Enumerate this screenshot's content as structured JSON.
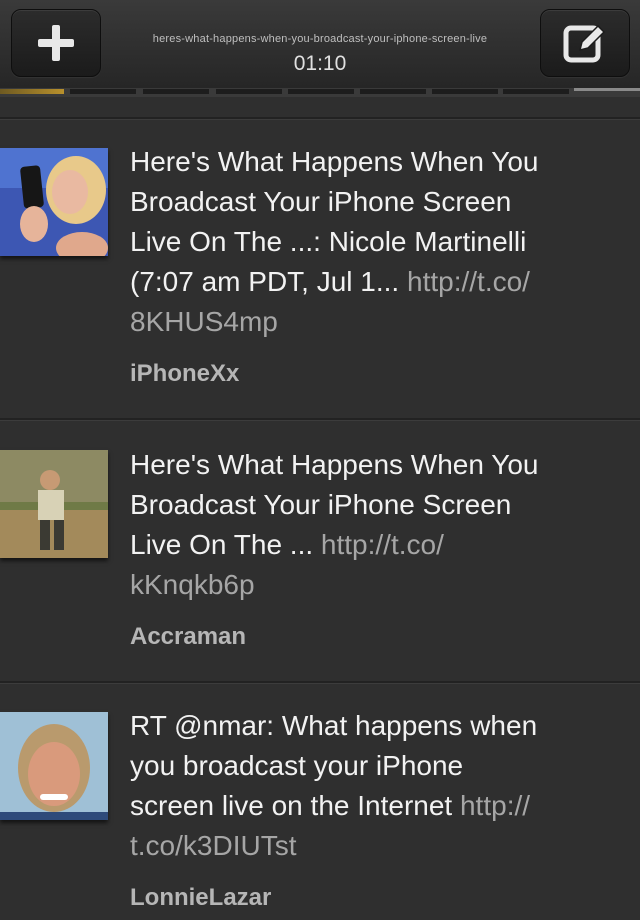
{
  "header": {
    "add_icon": "plus-icon",
    "compose_icon": "compose-icon",
    "title_slug": "heres-what-happens-when-you-broadcast-your-iphone-screen-live",
    "time": "01:10"
  },
  "playback": {
    "progress": 0.1
  },
  "tweets": [
    {
      "text_line1": "Here's What Happens When You",
      "text_line2": "Broadcast Your iPhone Screen",
      "text_line3": "Live On The ...: Nicole Martinelli",
      "text_line4": "(7:07 am PDT, Jul 1...",
      "link_part1": "http://t.co/",
      "link_part2": "8KHUS4mp",
      "author": "iPhoneXx"
    },
    {
      "text_line1": "Here's What Happens When You",
      "text_line2": "Broadcast Your iPhone Screen",
      "text_line3": "Live On The ...",
      "link_part1": "http://t.co/",
      "link_part2": "kKnqkb6p",
      "author": "Accraman"
    },
    {
      "text_line1": "RT @nmar: What happens when",
      "text_line2": "you broadcast your iPhone",
      "text_line3": "screen live on the Internet",
      "link_part1": "http://",
      "link_part2": "t.co/k3DIUTst",
      "author": "LonnieLazar"
    }
  ]
}
